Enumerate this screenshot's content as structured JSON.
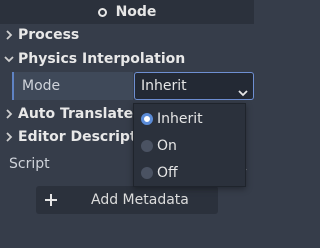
{
  "header": {
    "title": "Node",
    "icon": "circle-icon"
  },
  "sections": [
    {
      "label": "Process",
      "expanded": false
    },
    {
      "label": "Physics Interpolation",
      "expanded": true
    },
    {
      "label": "Auto Translate",
      "expanded": false
    },
    {
      "label": "Editor Descriptio",
      "expanded": false
    }
  ],
  "property": {
    "label": "Mode",
    "value": "Inherit"
  },
  "dropdown": {
    "options": [
      {
        "label": "Inherit",
        "selected": true
      },
      {
        "label": "On",
        "selected": false
      },
      {
        "label": "Off",
        "selected": false
      }
    ]
  },
  "script": {
    "label": "Script"
  },
  "metadata_button": {
    "label": "Add Metadata"
  },
  "colors": {
    "accent": "#6e8fd2",
    "background": "#363d4a",
    "panel": "#2b313c"
  }
}
